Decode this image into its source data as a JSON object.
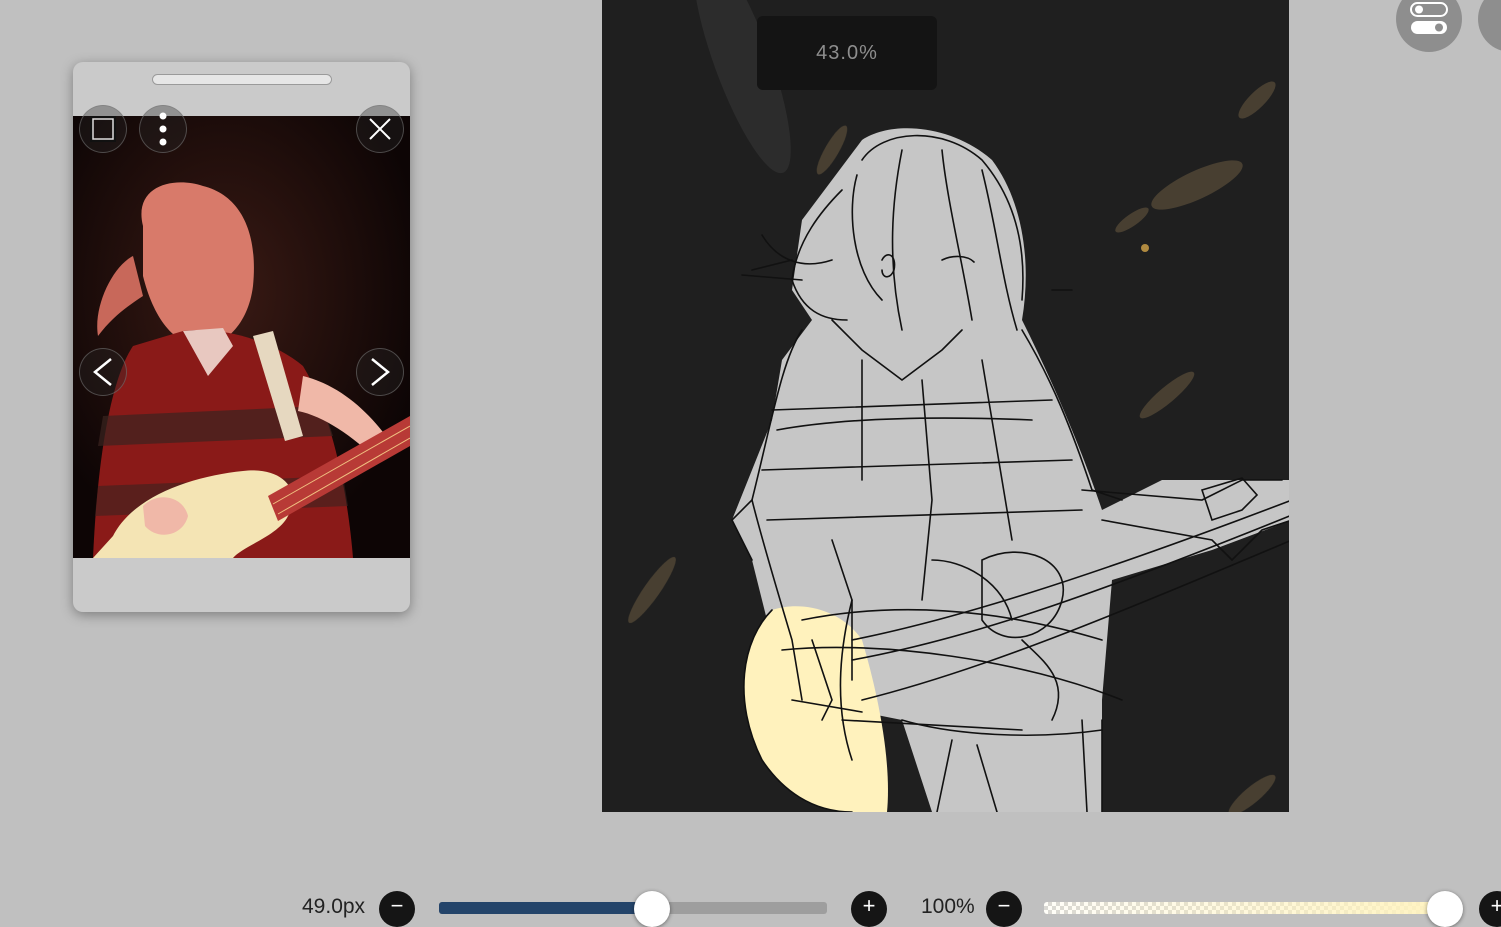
{
  "canvas": {
    "zoom_label": "43.0%"
  },
  "reference_window": {
    "buttons": [
      "frame-toggle",
      "more-options",
      "close",
      "previous",
      "next"
    ]
  },
  "top_right": {
    "buttons": [
      "settings-toggle-icon",
      "panel-icon"
    ]
  },
  "toolbar": {
    "brush_size": {
      "value_label": "49.0px",
      "decrease_label": "−",
      "increase_label": "+",
      "slider_fraction": 0.55
    },
    "opacity": {
      "value_label": "100%",
      "decrease_label": "−",
      "increase_label": "+",
      "slider_fraction": 0.96
    }
  },
  "colors": {
    "size_fill": "#24446a",
    "brush_color": "#fff3be",
    "background": "#c0c0c0"
  }
}
